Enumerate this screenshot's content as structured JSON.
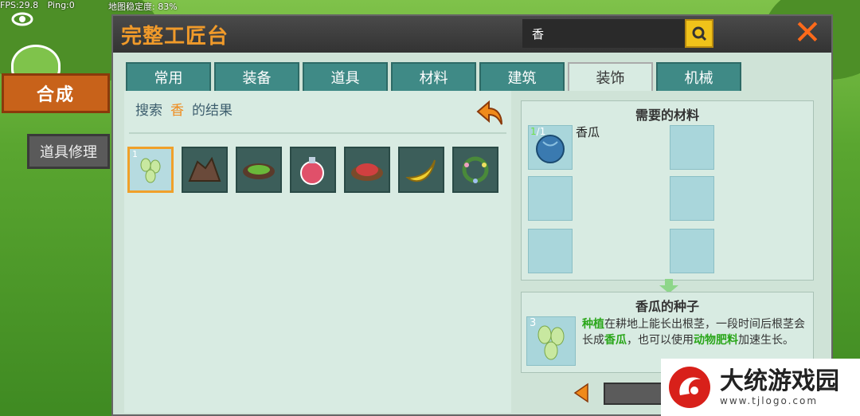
{
  "hud": {
    "fps": "FPS:29.8",
    "ping": "Ping:0",
    "stability": "地图稳定度: 83%"
  },
  "side_tabs": {
    "craft": "合成",
    "repair": "道具修理"
  },
  "window": {
    "title": "完整工匠台",
    "search_value": "香",
    "close_label": "✕"
  },
  "tabs": [
    "常用",
    "装备",
    "道具",
    "材料",
    "建筑",
    "装饰",
    "机械"
  ],
  "active_tab": "装饰",
  "search_result": {
    "prefix": "搜索",
    "keyword": "香",
    "suffix": "的结果"
  },
  "items": [
    {
      "name": "香瓜的种子",
      "count": "1",
      "icon": "seed-icon"
    },
    {
      "name": "rock",
      "count": "",
      "icon": "rock-icon"
    },
    {
      "name": "vegetable-dish",
      "count": "",
      "icon": "dish-icon"
    },
    {
      "name": "red-potion",
      "count": "",
      "icon": "potion-icon"
    },
    {
      "name": "meat-dish",
      "count": "",
      "icon": "meat-dish-icon"
    },
    {
      "name": "banana",
      "count": "",
      "icon": "banana-icon"
    },
    {
      "name": "flower-wreath",
      "count": "",
      "icon": "wreath-icon"
    }
  ],
  "materials": {
    "title": "需要的材料",
    "entries": [
      {
        "have": "1",
        "need": "/1",
        "name": "香瓜",
        "icon": "melon-icon"
      }
    ]
  },
  "result": {
    "title": "香瓜的种子",
    "count": "3",
    "desc_parts": [
      {
        "text": "种植",
        "hl": true
      },
      {
        "text": "在耕地上能长出根茎，一段时间后根茎会长成",
        "hl": false
      },
      {
        "text": "香瓜",
        "hl": true
      },
      {
        "text": "，也可以使用",
        "hl": false
      },
      {
        "text": "动物肥料",
        "hl": true
      },
      {
        "text": "加速生长。",
        "hl": false
      }
    ]
  },
  "watermark": {
    "title": "大统游戏园",
    "url": "www.tjlogo.com"
  },
  "colors": {
    "accent": "#f09a2a",
    "tab": "#3f8a86",
    "panel": "#d8ebe2",
    "highlight": "#2aa61a"
  }
}
